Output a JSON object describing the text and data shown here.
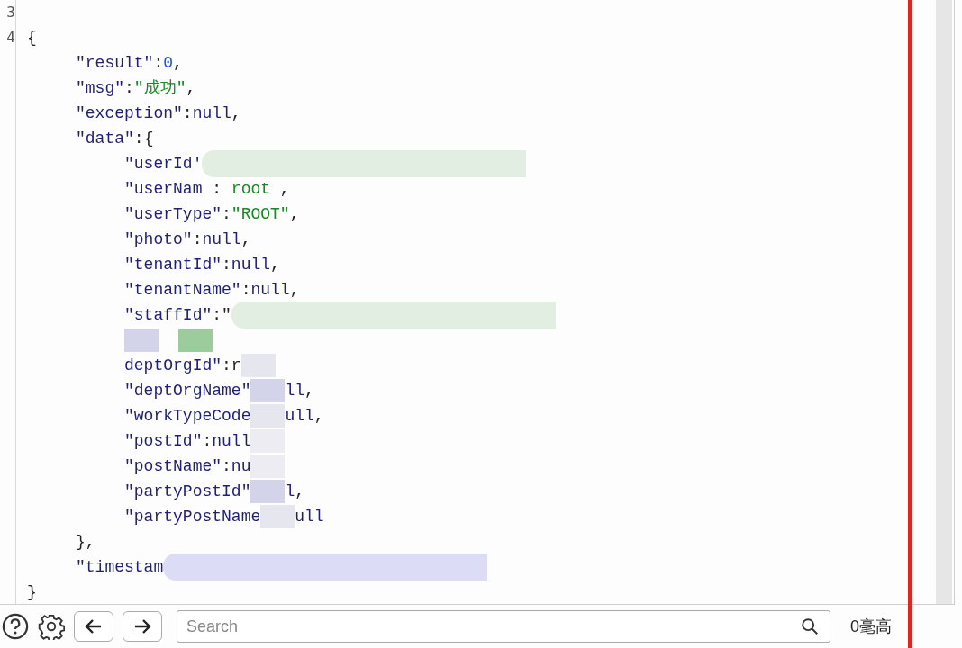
{
  "editor": {
    "lines": [
      {
        "number": "3"
      },
      {
        "number": "4",
        "tokens": [
          {
            "kind": "pun",
            "text": "{"
          }
        ]
      },
      {
        "tokens": [
          {
            "kind": "key",
            "text": "     \"result\""
          },
          {
            "kind": "pun",
            "text": ":"
          },
          {
            "kind": "num",
            "text": "0"
          },
          {
            "kind": "pun",
            "text": ","
          }
        ]
      },
      {
        "tokens": [
          {
            "kind": "key",
            "text": "     \"msg\""
          },
          {
            "kind": "pun",
            "text": ":"
          },
          {
            "kind": "str",
            "text": "\"成功\""
          },
          {
            "kind": "pun",
            "text": ","
          }
        ]
      },
      {
        "tokens": [
          {
            "kind": "key",
            "text": "     \"exception\""
          },
          {
            "kind": "pun",
            "text": ":"
          },
          {
            "kind": "nul",
            "text": "null"
          },
          {
            "kind": "pun",
            "text": ","
          }
        ]
      },
      {
        "tokens": [
          {
            "kind": "key",
            "text": "     \"data\""
          },
          {
            "kind": "pun",
            "text": ":{"
          }
        ]
      },
      {
        "tokens": [
          {
            "kind": "key",
            "text": "          \"userId'"
          },
          {
            "kind": "band",
            "color": "#e3eee3"
          }
        ]
      },
      {
        "tokens": [
          {
            "kind": "key",
            "text": "          \"userNam"
          },
          {
            "kind": "pun",
            "text": " : "
          },
          {
            "kind": "str",
            "text": "root"
          },
          {
            "kind": "pun",
            "text": " ,"
          }
        ]
      },
      {
        "tokens": [
          {
            "kind": "key",
            "text": "          \"userType\""
          },
          {
            "kind": "pun",
            "text": ":"
          },
          {
            "kind": "str",
            "text": "\"ROOT\""
          },
          {
            "kind": "pun",
            "text": ","
          }
        ]
      },
      {
        "tokens": [
          {
            "kind": "key",
            "text": "          \"photo\""
          },
          {
            "kind": "pun",
            "text": ":"
          },
          {
            "kind": "nul",
            "text": "null"
          },
          {
            "kind": "pun",
            "text": ","
          }
        ]
      },
      {
        "tokens": [
          {
            "kind": "key",
            "text": "          \"tenantId\""
          },
          {
            "kind": "pun",
            "text": ":"
          },
          {
            "kind": "nul",
            "text": "null"
          },
          {
            "kind": "pun",
            "text": ","
          }
        ]
      },
      {
        "tokens": [
          {
            "kind": "key",
            "text": "          \"tenantName\""
          },
          {
            "kind": "pun",
            "text": ":"
          },
          {
            "kind": "nul",
            "text": "null"
          },
          {
            "kind": "pun",
            "text": ","
          }
        ]
      },
      {
        "tokens": [
          {
            "kind": "key",
            "text": "          \"staffId\""
          },
          {
            "kind": "pun",
            "text": ":\""
          },
          {
            "kind": "band",
            "color": "#e3eee3"
          }
        ]
      },
      {
        "tokens": [
          {
            "kind": "indent"
          },
          {
            "kind": "mask",
            "color": "#d3d3ea"
          },
          {
            "kind": "gap"
          },
          {
            "kind": "mask",
            "color": "#9ccc9c"
          }
        ]
      },
      {
        "tokens": [
          {
            "kind": "key",
            "text": "          deptOrgId\""
          },
          {
            "kind": "pun",
            "text": ":r"
          },
          {
            "kind": "mask",
            "color": "#e6e6ee"
          }
        ]
      },
      {
        "tokens": [
          {
            "kind": "key",
            "text": "          \"deptOrgName\""
          },
          {
            "kind": "mask",
            "color": "#d3d3ea"
          },
          {
            "kind": "nul",
            "text": "ll"
          },
          {
            "kind": "pun",
            "text": ","
          }
        ]
      },
      {
        "tokens": [
          {
            "kind": "key",
            "text": "          \"workTypeCode"
          },
          {
            "kind": "mask",
            "color": "#e6e6ee"
          },
          {
            "kind": "nul",
            "text": "ull"
          },
          {
            "kind": "pun",
            "text": ","
          }
        ]
      },
      {
        "tokens": [
          {
            "kind": "key",
            "text": "          \"postId\""
          },
          {
            "kind": "pun",
            "text": ":"
          },
          {
            "kind": "nul",
            "text": "null"
          },
          {
            "kind": "mask",
            "color": "#ececf2"
          }
        ]
      },
      {
        "tokens": [
          {
            "kind": "key",
            "text": "          \"postName\""
          },
          {
            "kind": "pun",
            "text": ":"
          },
          {
            "kind": "nul",
            "text": "nu"
          },
          {
            "kind": "mask",
            "color": "#ececf2"
          }
        ]
      },
      {
        "tokens": [
          {
            "kind": "key",
            "text": "          \"partyPostId\""
          },
          {
            "kind": "mask",
            "color": "#d3d3ea"
          },
          {
            "kind": "nul",
            "text": "l"
          },
          {
            "kind": "pun",
            "text": ","
          }
        ]
      },
      {
        "tokens": [
          {
            "kind": "key",
            "text": "          \"partyPostName"
          },
          {
            "kind": "mask",
            "color": "#e6e6ee"
          },
          {
            "kind": "nul",
            "text": "ull"
          }
        ]
      },
      {
        "tokens": [
          {
            "kind": "pun",
            "text": "     },"
          }
        ]
      },
      {
        "tokens": [
          {
            "kind": "key",
            "text": "     \"timestam"
          },
          {
            "kind": "band",
            "color": "#dcdcf6"
          }
        ]
      },
      {
        "tokens": [
          {
            "kind": "pun",
            "text": "}"
          }
        ]
      }
    ]
  },
  "toolbar": {
    "search": {
      "placeholder": "Search"
    },
    "timing": "0毫高"
  }
}
